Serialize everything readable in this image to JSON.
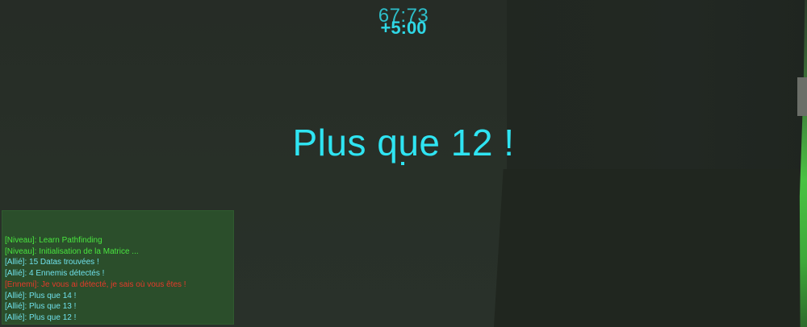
{
  "hud": {
    "timer": "67:73",
    "time_bonus": "+5:00",
    "announcement": "Plus que 12 !"
  },
  "chat": {
    "messages": [
      {
        "type": "niveau",
        "text": "[Niveau]: Learn Pathfinding"
      },
      {
        "type": "niveau",
        "text": "[Niveau]: Initialisation de la Matrice ..."
      },
      {
        "type": "allie",
        "text": "[Allié]: 15 Datas trouvées !"
      },
      {
        "type": "allie",
        "text": "[Allié]: 4 Ennemis détectés !"
      },
      {
        "type": "ennemi",
        "text": "[Ennemi]: Je vous ai détecté, je sais où vous êtes !"
      },
      {
        "type": "allie",
        "text": "[Allié]: Plus que 14 !"
      },
      {
        "type": "allie",
        "text": "[Allié]: Plus que 13 !"
      },
      {
        "type": "allie",
        "text": "[Allié]: Plus que 12 !"
      }
    ]
  },
  "colors": {
    "hud_cyan": "#2fe4f2",
    "niveau_green": "#49e53f",
    "allie_cyan": "#6fe0ea",
    "ennemi_red": "#e53a2a",
    "chat_bg": "#2c542c"
  }
}
